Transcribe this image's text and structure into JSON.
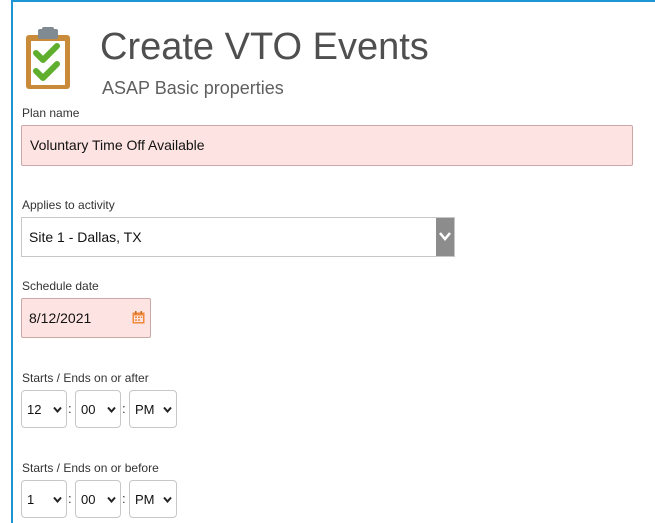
{
  "header": {
    "title": "Create VTO Events",
    "subtitle": "ASAP Basic properties",
    "icon": "clipboard-checklist-icon"
  },
  "form": {
    "plan_name": {
      "label": "Plan name",
      "value": "Voluntary Time Off Available"
    },
    "activity": {
      "label": "Applies to activity",
      "value": "Site 1 - Dallas, TX"
    },
    "schedule_date": {
      "label": "Schedule date",
      "value": "8/12/2021",
      "icon": "calendar-icon"
    },
    "start": {
      "label": "Starts / Ends on or after",
      "hour": "12",
      "minute": "00",
      "ampm": "PM",
      "separator": ":"
    },
    "end": {
      "label": "Starts / Ends on or before",
      "hour": "1",
      "minute": "00",
      "ampm": "PM",
      "separator": ":"
    }
  },
  "colors": {
    "accent": "#1e96d6",
    "invalid_field_bg": "#fde3e1",
    "calendar_icon": "#f08a3c",
    "check_green": "#5fae2e",
    "clipboard": "#c98b3a"
  }
}
